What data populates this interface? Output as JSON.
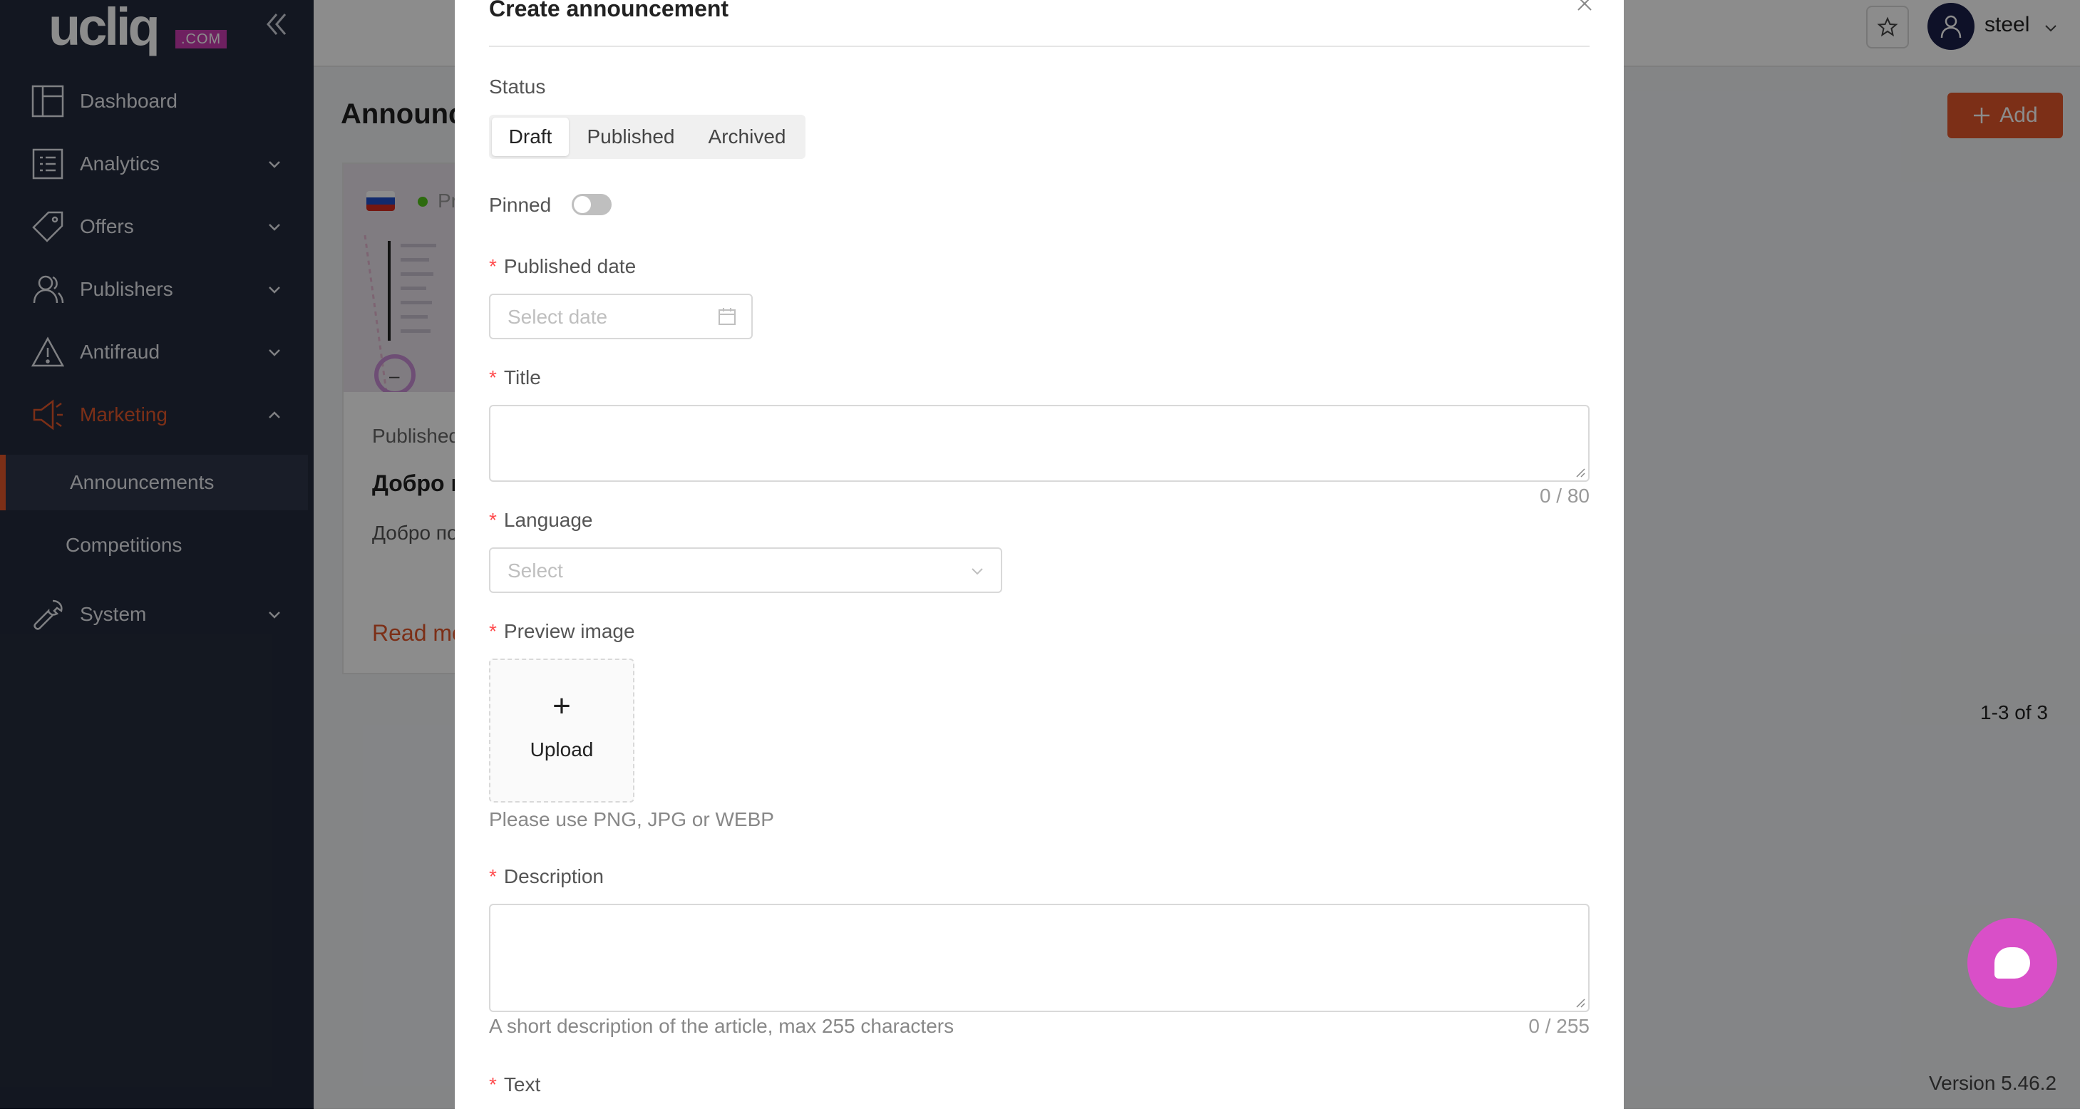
{
  "brand": {
    "logo_text": "ucliq",
    "logo_suffix": ".COM"
  },
  "sidebar": {
    "items": [
      {
        "label": "Dashboard"
      },
      {
        "label": "Analytics"
      },
      {
        "label": "Offers"
      },
      {
        "label": "Publishers"
      },
      {
        "label": "Antifraud"
      },
      {
        "label": "Marketing"
      },
      {
        "label": "System"
      }
    ],
    "marketing_sub": [
      {
        "label": "Announcements"
      },
      {
        "label": "Competitions"
      }
    ]
  },
  "header": {
    "username": "steel"
  },
  "page": {
    "title": "Announc",
    "add_label": "Add",
    "pagination": "1-3 of 3",
    "version": "Version 5.46.2"
  },
  "card": {
    "status": "Pr",
    "published": "Published",
    "title": "Добро п",
    "description": "Добро по",
    "read_more": "Read mo"
  },
  "modal": {
    "title": "Create announcement",
    "status_label": "Status",
    "status_options": [
      "Draft",
      "Published",
      "Archived"
    ],
    "status_selected": "Draft",
    "pinned_label": "Pinned",
    "pinned": false,
    "published_date_label": "Published date",
    "published_date_placeholder": "Select date",
    "title_label": "Title",
    "title_counter": "0 / 80",
    "language_label": "Language",
    "language_placeholder": "Select",
    "preview_label": "Preview image",
    "upload_plus": "+",
    "upload_label": "Upload",
    "upload_hint": "Please use PNG, JPG or WEBP",
    "description_label": "Description",
    "description_hint": "A short description of the article, max 255 characters",
    "description_counter": "0 / 255",
    "text_label": "Text"
  },
  "colors": {
    "sidebar_bg": "#242b3d",
    "accent": "#e2572a",
    "chat": "#d94fc8",
    "required": "#ff4d4f"
  }
}
